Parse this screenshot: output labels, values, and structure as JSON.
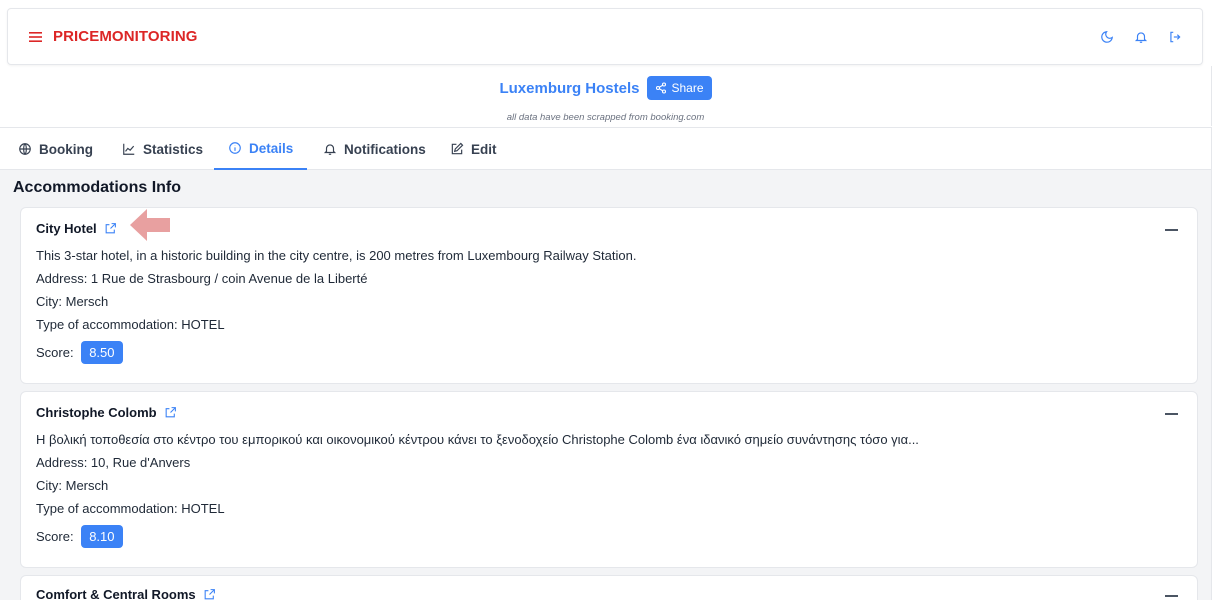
{
  "app": {
    "brand": "PRICEMONITORING",
    "icons": [
      "menu-icon",
      "moon-icon",
      "bell-icon",
      "logout-icon"
    ]
  },
  "page": {
    "title": "Luxemburg Hostels",
    "share_label": "Share",
    "subtitle": "all data have been scrapped from booking.com"
  },
  "tabs": [
    {
      "label": "Booking",
      "icon": "globe-icon",
      "active": false
    },
    {
      "label": "Statistics",
      "icon": "chart-line-icon",
      "active": false
    },
    {
      "label": "Details",
      "icon": "info-icon",
      "active": true
    },
    {
      "label": "Notifications",
      "icon": "bell-icon",
      "active": false
    },
    {
      "label": "Edit",
      "icon": "edit-icon",
      "active": false
    }
  ],
  "section": {
    "title": "Accommodations Info"
  },
  "accommodations": [
    {
      "name": "City Hotel",
      "description": "This 3-star hotel, in a historic building in the city centre, is 200 metres from Luxembourg Railway Station.",
      "address": "Address: 1 Rue de Strasbourg / coin Avenue de la Liberté",
      "city": "City: Mersch",
      "type": "Type of accommodation: HOTEL",
      "score_label": "Score:",
      "score": "8.50"
    },
    {
      "name": "Christophe Colomb",
      "description": "Η βολική τοποθεσία στο κέντρο του εμπορικού και οικονομικού κέντρου κάνει το ξενοδοχείο Christophe Colomb ένα ιδανικό σημείο συνάντησης τόσο για...",
      "address": "Address: 10, Rue d'Anvers",
      "city": "City: Mersch",
      "type": "Type of accommodation: HOTEL",
      "score_label": "Score:",
      "score": "8.10"
    },
    {
      "name": "Comfort & Central Rooms"
    }
  ],
  "colors": {
    "brand": "#dc2626",
    "accent": "#3b82f6",
    "arrow": "#e8a0a0"
  }
}
